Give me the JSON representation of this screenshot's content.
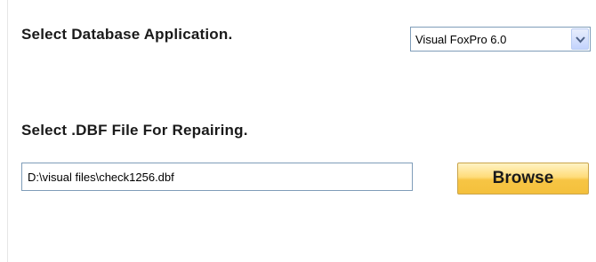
{
  "database_section": {
    "label": "Select Database Application.",
    "selected_value": "Visual FoxPro 6.0"
  },
  "file_section": {
    "label": "Select .DBF File For Repairing.",
    "path_value": "D:\\visual files\\check1256.dbf",
    "browse_label": "Browse"
  },
  "icons": {
    "dropdown": "chevron-down-icon"
  },
  "colors": {
    "button_gold": "#f7c544",
    "field_border": "#7f9db9",
    "dropdown_arrow": "#4d6185"
  }
}
